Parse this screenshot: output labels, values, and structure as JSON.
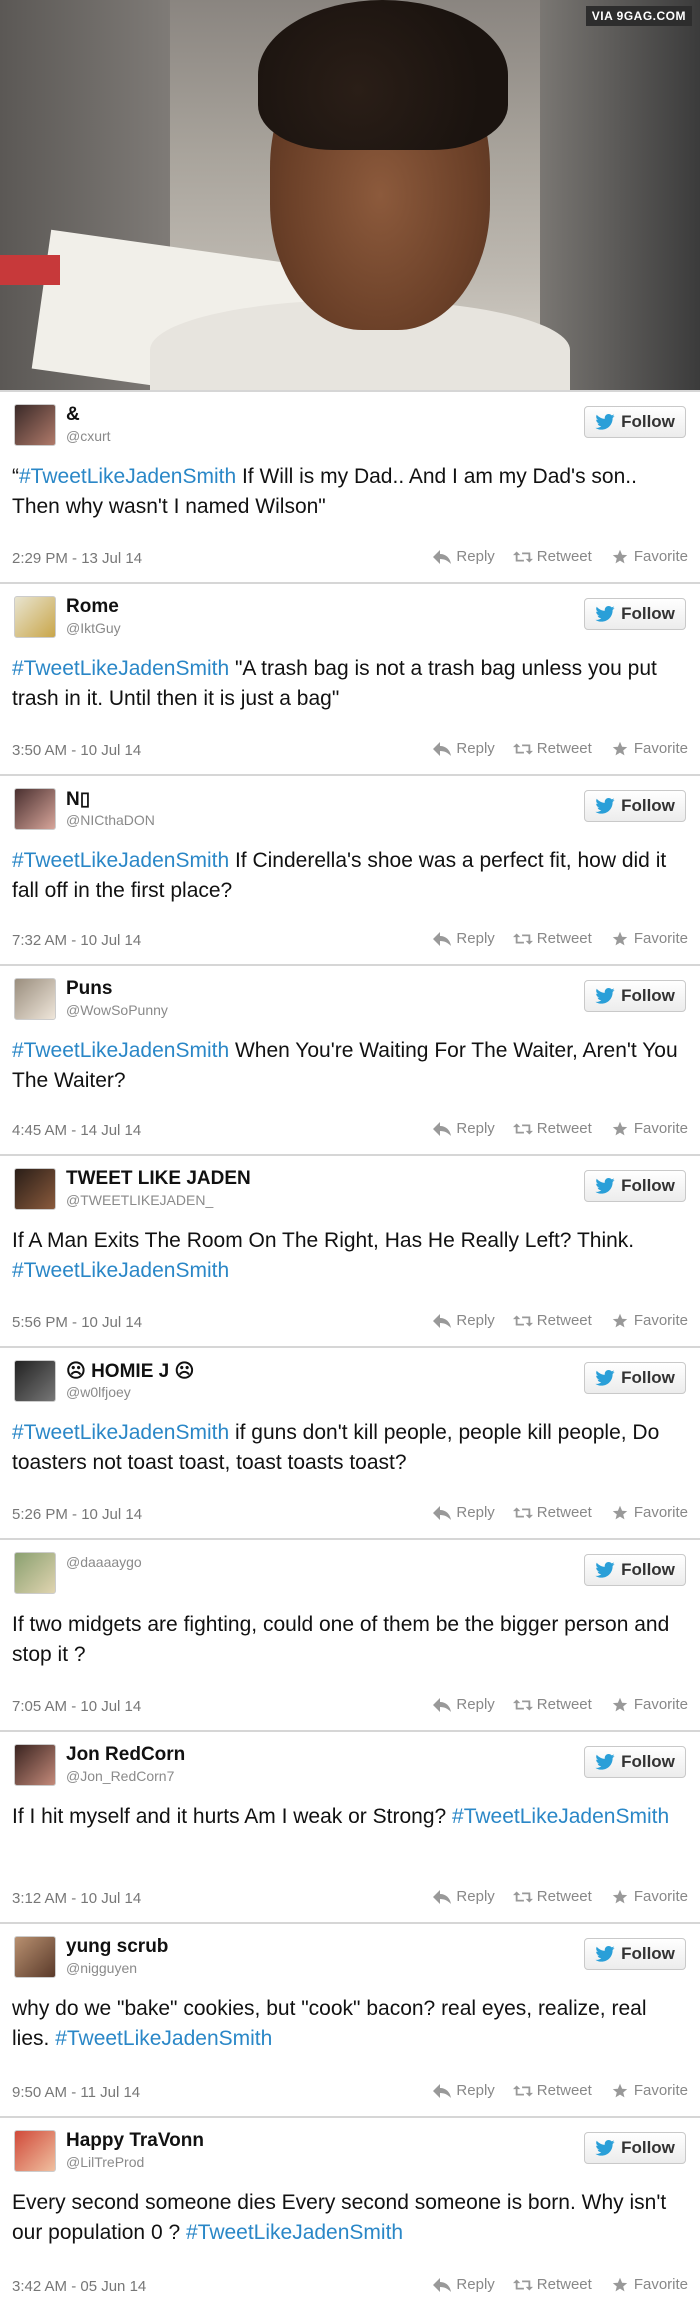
{
  "source_badge": "VIA 9GAG.COM",
  "ui": {
    "follow_label": "Follow",
    "reply_label": "Reply",
    "retweet_label": "Retweet",
    "favorite_label": "Favorite",
    "accent_color": "#2a87c7"
  },
  "tweets": [
    {
      "name": "&",
      "handle": "@cxurt",
      "pre": "“",
      "tag1": "#TweetLikeJadenSmith",
      "text": " If Will is my Dad.. And I am my Dad's son.. Then why wasn't I named Wilson\"",
      "tag2": "",
      "time": "2:29 PM - 13 Jul 14"
    },
    {
      "name": "Rome",
      "handle": "@IktGuy",
      "pre": "",
      "tag1": "#TweetLikeJadenSmith",
      "text": " \"A trash bag is not a trash bag unless you put trash in it. Until then it is just a bag\"",
      "tag2": "",
      "time": "3:50 AM - 10 Jul 14"
    },
    {
      "name": "N▯",
      "handle": "@NICthaDON",
      "pre": "",
      "tag1": "#TweetLikeJadenSmith",
      "text": " If Cinderella's shoe was a perfect fit, how did it fall off in the first place?",
      "tag2": "",
      "time": "7:32 AM - 10 Jul 14"
    },
    {
      "name": "Puns",
      "handle": "@WowSoPunny",
      "pre": "",
      "tag1": "#TweetLikeJadenSmith",
      "text": " When You're Waiting For The Waiter, Aren't You The Waiter?",
      "tag2": "",
      "time": "4:45 AM - 14 Jul 14"
    },
    {
      "name": "TWEET LIKE JADEN",
      "handle": "@TWEETLIKEJADEN_",
      "pre": "",
      "tag1": "",
      "text": "If A Man Exits The Room On The Right, Has He Really Left? Think. ",
      "tag2": "#TweetLikeJadenSmith",
      "time": "5:56 PM - 10 Jul 14"
    },
    {
      "name": "☹ HOMIE J ☹",
      "handle": "@w0lfjoey",
      "pre": "",
      "tag1": "#TweetLikeJadenSmith",
      "text": " if guns don't kill people, people kill people, Do toasters not toast toast, toast toasts toast?",
      "tag2": "",
      "time": "5:26 PM - 10 Jul 14"
    },
    {
      "name": "",
      "handle": "@daaaaygo",
      "pre": "",
      "tag1": "",
      "text": "If two midgets are fighting, could one of them be the bigger person and stop it ?",
      "tag2": "",
      "time": "7:05 AM - 10 Jul 14"
    },
    {
      "name": "Jon RedCorn",
      "handle": "@Jon_RedCorn7",
      "pre": "",
      "tag1": "",
      "text": "If I hit myself and it hurts Am I weak or Strong? ",
      "tag2": "#TweetLikeJadenSmith",
      "time": "3:12 AM - 10 Jul 14"
    },
    {
      "name": "yung scrub",
      "handle": "@nigguyen",
      "pre": "",
      "tag1": "",
      "text": "why do we \"bake\" cookies, but \"cook\" bacon? real eyes, realize, real lies. ",
      "tag2": "#TweetLikeJadenSmith",
      "time": "9:50 AM - 11 Jul 14"
    },
    {
      "name": "Happy TraVonn",
      "handle": "@LilTreProd",
      "pre": "",
      "tag1": "",
      "text": "Every second someone dies Every second someone is born. Why isn't our population 0 ? ",
      "tag2": "#TweetLikeJadenSmith",
      "time": "3:42 AM - 05 Jun 14"
    }
  ]
}
